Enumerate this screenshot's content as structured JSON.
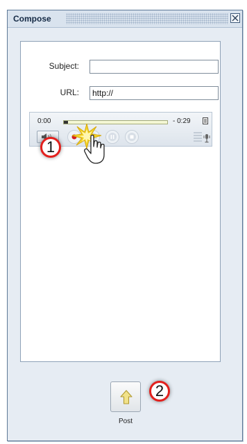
{
  "window": {
    "title": "Compose",
    "close_icon": "close-icon"
  },
  "form": {
    "subject_label": "Subject:",
    "subject_value": "",
    "url_label": "URL:",
    "url_value": "http://"
  },
  "player": {
    "elapsed": "0:00",
    "remaining": "- 0:29",
    "progress_fraction": 0,
    "buttons": [
      "volume-icon",
      "record-icon",
      "play-icon",
      "pause-icon",
      "stop-icon"
    ]
  },
  "post": {
    "label": "Post",
    "icon": "up-arrow-icon"
  },
  "callouts": {
    "step1": "1",
    "step2": "2"
  },
  "colors": {
    "record": "#d42020",
    "callout_ring": "#e3201d",
    "arrow": "#f1e28a",
    "frame_border": "#5d7896"
  }
}
